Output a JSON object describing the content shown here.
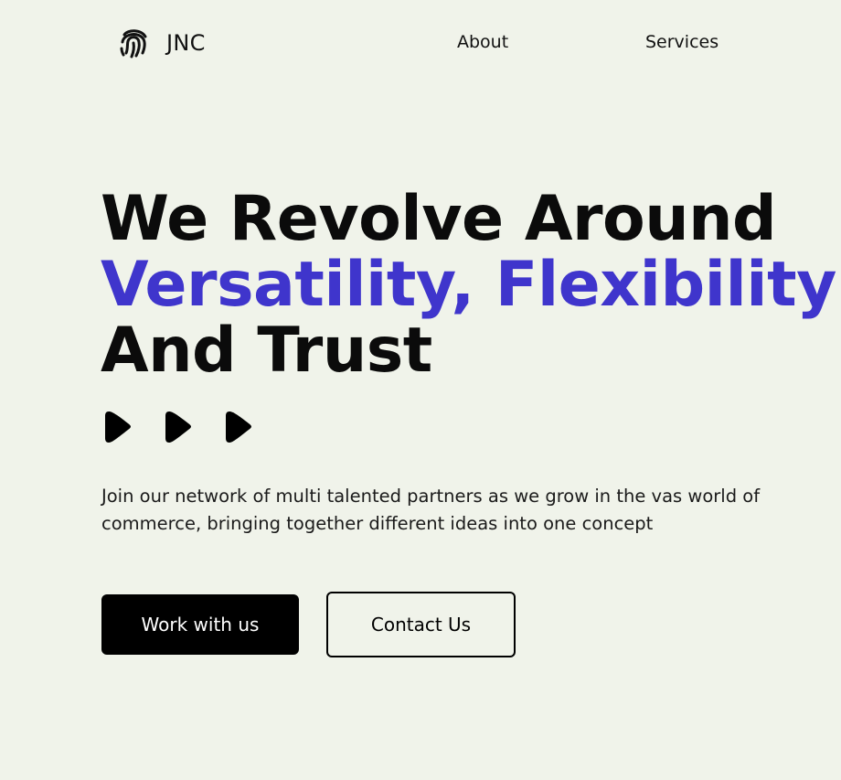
{
  "header": {
    "brand_name": "JNC",
    "brand_icon": "fingerprint-icon",
    "nav": [
      {
        "label": "About"
      },
      {
        "label": "Services"
      }
    ]
  },
  "hero": {
    "title_lines": [
      "We Revolve Around",
      "Versatility, Flexibility",
      "And Trust"
    ],
    "accent_color": "#3f35cc",
    "arrow_icons": [
      "play-arrow-icon",
      "play-arrow-icon",
      "play-arrow-icon"
    ],
    "description": "Join our network of multi talented partners as we grow in the vas world of commerce, bringing together different ideas into one concept",
    "primary_button": "Work with us",
    "secondary_button": "Contact Us"
  },
  "colors": {
    "background": "#f0f3ea",
    "text": "#0b0b0b",
    "accent": "#3f35cc",
    "button_primary_bg": "#000000"
  }
}
